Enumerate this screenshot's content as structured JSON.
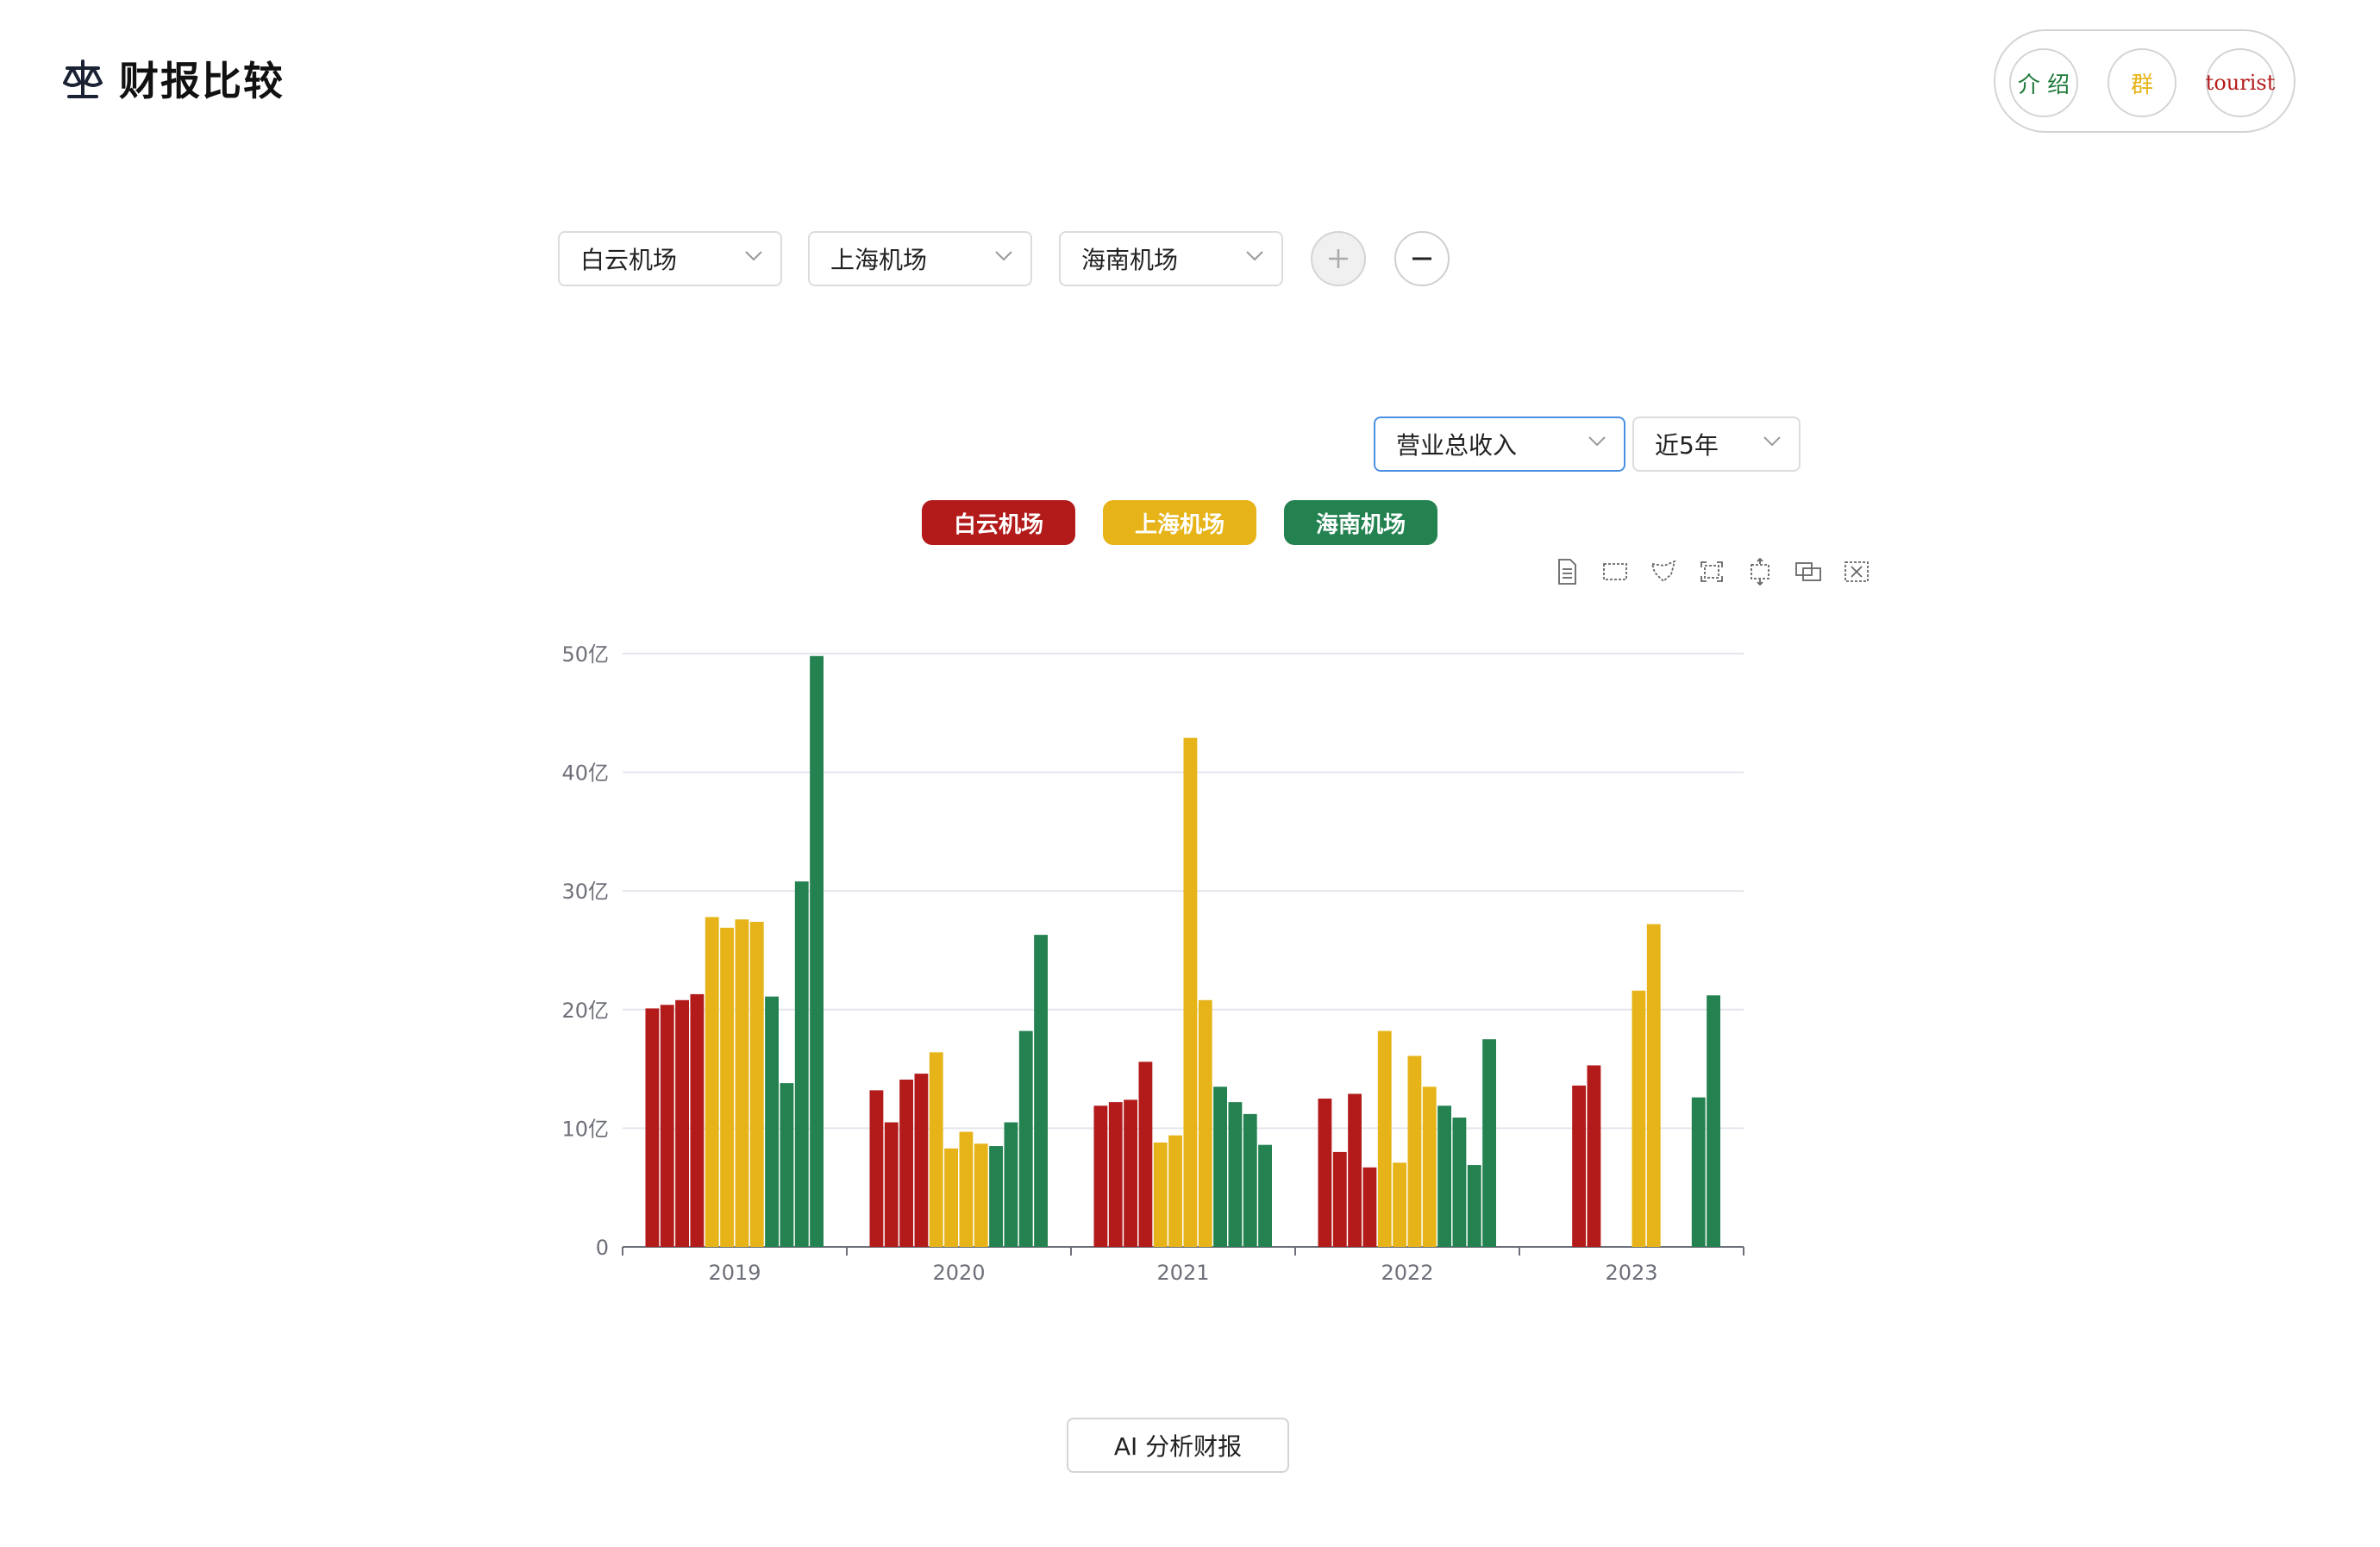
{
  "brand": {
    "title": "财报比较",
    "icon": "balance-scale-icon"
  },
  "top_nav": {
    "intro_label": "介 绍",
    "group_label": "群",
    "user_label": "tourist"
  },
  "company_selects": [
    {
      "value": "白云机场"
    },
    {
      "value": "上海机场"
    },
    {
      "value": "海南机场"
    }
  ],
  "metric_select": {
    "value": "营业总收入"
  },
  "range_select": {
    "value": "近5年"
  },
  "ai_button": {
    "label": "AI 分析财报"
  },
  "colors": {
    "baiyun": "#b31b1b",
    "shanghai": "#e6b419",
    "hainan": "#238250"
  },
  "chart_data": {
    "type": "bar",
    "categories": [
      "2019",
      "2020",
      "2021",
      "2022",
      "2023"
    ],
    "ylim": [
      0,
      50
    ],
    "y_ticks": [
      "0",
      "10亿",
      "20亿",
      "30亿",
      "40亿",
      "50亿"
    ],
    "unit": "亿",
    "grid": true,
    "legend_position": "top-center",
    "series": [
      {
        "name": "白云机场",
        "color": "#b31b1b",
        "values": [
          [
            20.1,
            20.4,
            20.8,
            21.3
          ],
          [
            13.2,
            10.5,
            14.1,
            14.6
          ],
          [
            11.9,
            12.2,
            12.4,
            15.6
          ],
          [
            12.5,
            8.0,
            12.9,
            6.7
          ],
          [
            null,
            null,
            13.6,
            15.3
          ]
        ]
      },
      {
        "name": "上海机场",
        "color": "#e6b419",
        "values": [
          [
            27.8,
            26.9,
            27.6,
            27.4
          ],
          [
            16.4,
            8.3,
            9.7,
            8.7
          ],
          [
            8.8,
            9.4,
            42.9,
            20.8
          ],
          [
            18.2,
            7.1,
            16.1,
            13.5
          ],
          [
            null,
            null,
            21.6,
            27.2
          ]
        ]
      },
      {
        "name": "海南机场",
        "color": "#238250",
        "values": [
          [
            21.1,
            13.8,
            30.8,
            49.8
          ],
          [
            8.5,
            10.5,
            18.2,
            26.3
          ],
          [
            13.5,
            12.2,
            11.2,
            8.6
          ],
          [
            11.9,
            10.9,
            6.9,
            17.5
          ],
          [
            null,
            null,
            12.6,
            21.2
          ]
        ]
      }
    ]
  }
}
